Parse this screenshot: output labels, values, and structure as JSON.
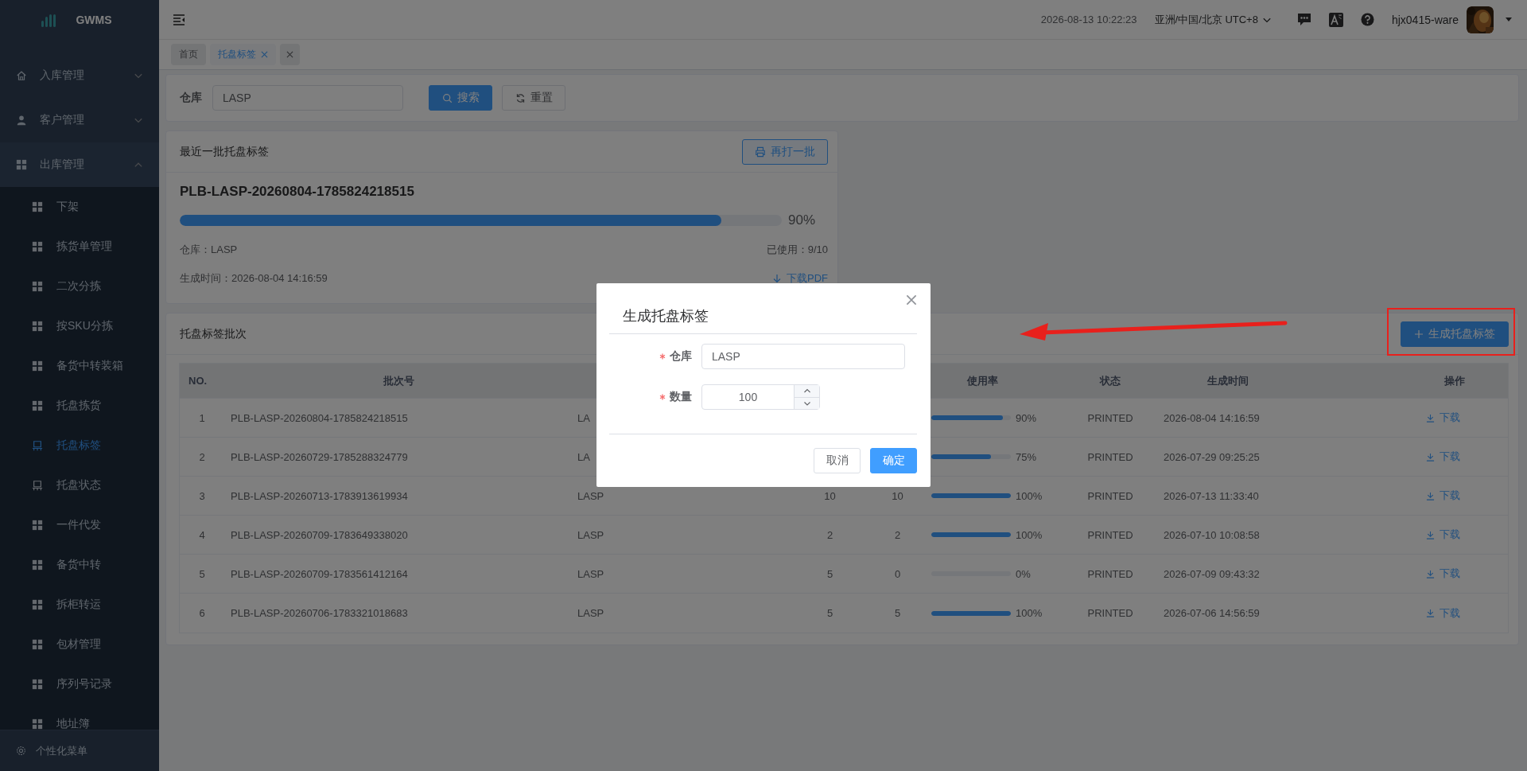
{
  "app": {
    "logo_text": "GWMS"
  },
  "sidebar": {
    "items": [
      {
        "label": "入库管理",
        "expanded": false
      },
      {
        "label": "客户管理",
        "expanded": false
      },
      {
        "label": "出库管理",
        "expanded": true,
        "children": [
          {
            "label": "下架",
            "kind": "grid",
            "selected": false
          },
          {
            "label": "拣货单管理",
            "kind": "grid",
            "selected": false
          },
          {
            "label": "二次分拣",
            "kind": "grid",
            "selected": false
          },
          {
            "label": "按SKU分拣",
            "kind": "grid",
            "selected": false
          },
          {
            "label": "备货中转装箱",
            "kind": "grid",
            "selected": false
          },
          {
            "label": "托盘拣货",
            "kind": "grid",
            "selected": false
          },
          {
            "label": "托盘标签",
            "kind": "pallet",
            "selected": true
          },
          {
            "label": "托盘状态",
            "kind": "pallet",
            "selected": false
          },
          {
            "label": "一件代发",
            "kind": "grid",
            "selected": false
          },
          {
            "label": "备货中转",
            "kind": "grid",
            "selected": false
          },
          {
            "label": "拆柜转运",
            "kind": "grid",
            "selected": false
          },
          {
            "label": "包材管理",
            "kind": "grid",
            "selected": false
          },
          {
            "label": "序列号记录",
            "kind": "grid",
            "selected": false
          },
          {
            "label": "地址簿",
            "kind": "grid",
            "selected": false
          }
        ]
      }
    ],
    "footer": "个性化菜单"
  },
  "header": {
    "datetime": "2026-08-13 10:22:23",
    "timezone": "亚洲/中国/北京 UTC+8",
    "username": "hjx0415-ware"
  },
  "tabs": [
    {
      "label": "首页",
      "selected": false,
      "closable": false
    },
    {
      "label": "托盘标签",
      "selected": true,
      "closable": true
    }
  ],
  "search": {
    "label": "仓库",
    "value": "LASP",
    "buttons": [
      "搜索",
      "重置"
    ]
  },
  "latest_batch": {
    "title": "最近一批托盘标签",
    "reprint_button": "再打一批",
    "batch_no": "PLB-LASP-20260804-1785824218515",
    "level": 0.9,
    "reading": "90%",
    "warehouse": "仓库：LASP",
    "used": "已使用：9/10",
    "created": "生成时间：2026-08-04 14:16:59",
    "download": "下载PDF"
  },
  "batches": {
    "title": "托盘标签批次",
    "create_button": "生成托盘标签",
    "table": {
      "columns": {
        "no": "NO.",
        "batch": "批次号",
        "usage": "使用率",
        "status": "状态",
        "time": "生成时间",
        "action": "操作"
      },
      "rows": [
        {
          "no": "1",
          "batch": "PLB-LASP-20260804-1785824218515",
          "column_3": "LA",
          "level": 0.9,
          "reading": "90%",
          "status": "PRINTED",
          "time": "2026-08-04 14:16:59",
          "action": "下载"
        },
        {
          "no": "2",
          "batch": "PLB-LASP-20260729-1785288324779",
          "column_3": "LA",
          "level": 0.75,
          "reading": "75%",
          "status": "PRINTED",
          "time": "2026-07-29 09:25:25",
          "action": "下载"
        },
        {
          "no": "3",
          "batch": "PLB-LASP-20260713-1783913619934",
          "column_3": "LASP",
          "column_4": "10",
          "column_5": "10",
          "level": 1,
          "reading": "100%",
          "status": "PRINTED",
          "time": "2026-07-13 11:33:40",
          "action": "下载"
        },
        {
          "no": "4",
          "batch": "PLB-LASP-20260709-1783649338020",
          "column_3": "LASP",
          "column_4": "2",
          "column_5": "2",
          "level": 1,
          "reading": "100%",
          "status": "PRINTED",
          "time": "2026-07-10 10:08:58",
          "action": "下载"
        },
        {
          "no": "5",
          "batch": "PLB-LASP-20260709-1783561412164",
          "column_3": "LASP",
          "column_4": "5",
          "column_5": "0",
          "level": 0,
          "reading": "0%",
          "status": "PRINTED",
          "time": "2026-07-09 09:43:32",
          "action": "下载"
        },
        {
          "no": "6",
          "batch": "PLB-LASP-20260706-1783321018683",
          "column_3": "LASP",
          "column_4": "5",
          "column_5": "5",
          "level": 1,
          "reading": "100%",
          "status": "PRINTED",
          "time": "2026-07-06 14:56:59",
          "action": "下载"
        }
      ]
    }
  },
  "dialog": {
    "title": "生成托盘标签",
    "fields": [
      {
        "label": "仓库",
        "required": true,
        "kind": "text",
        "value": "LASP"
      },
      {
        "label": "数量",
        "required": true,
        "kind": "number",
        "value": "100"
      }
    ],
    "buttons": [
      {
        "label": "取消",
        "kind": "default"
      },
      {
        "label": "确定",
        "kind": "primary"
      }
    ]
  }
}
